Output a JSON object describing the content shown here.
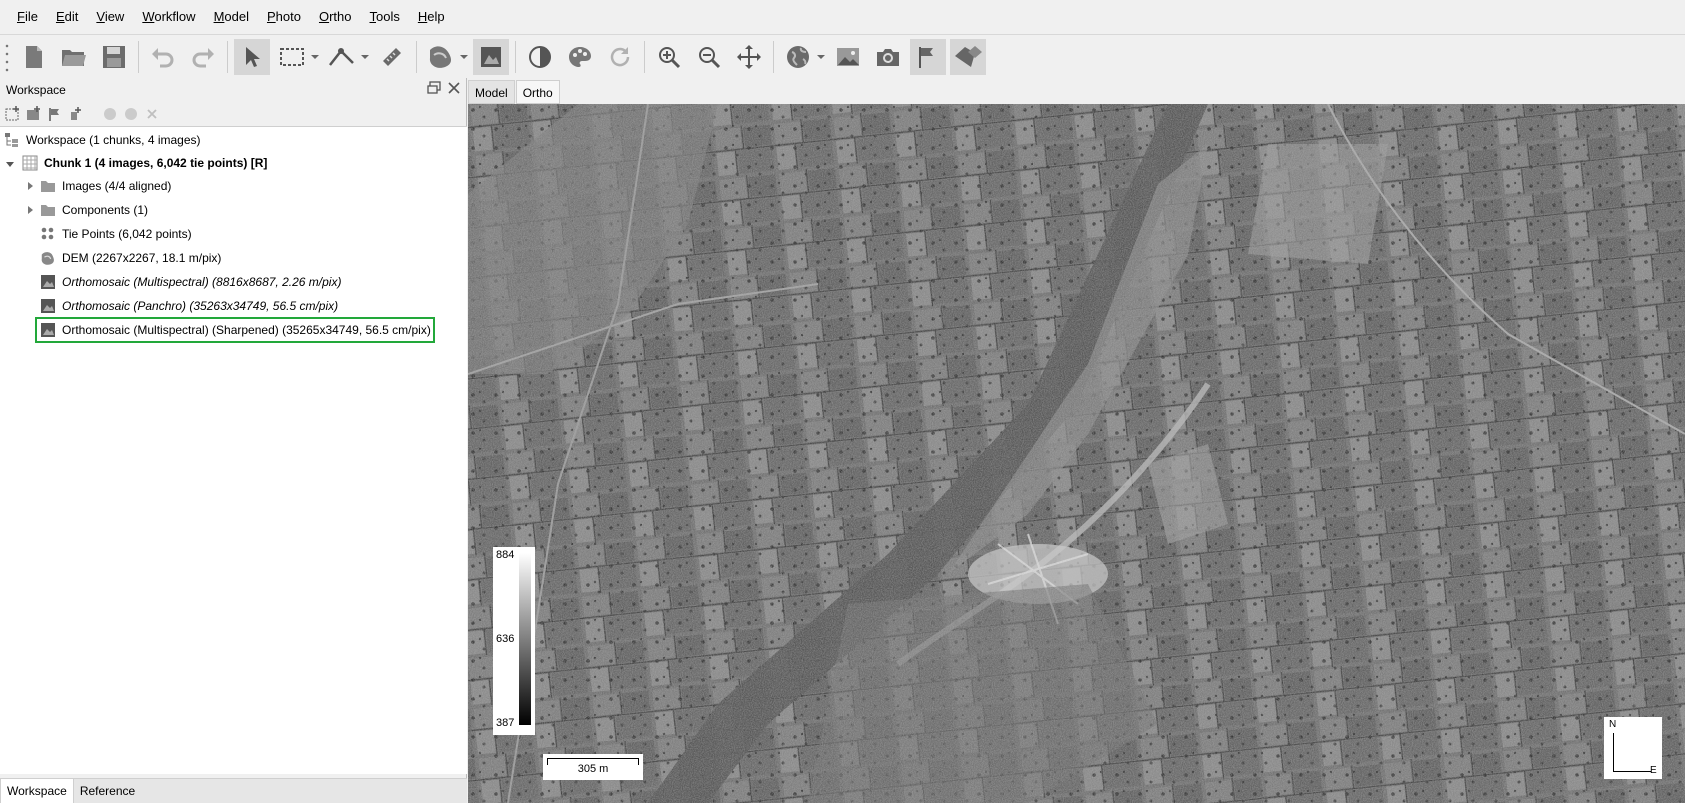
{
  "menu": [
    {
      "label": "File",
      "u": "F",
      "rest": "ile"
    },
    {
      "label": "Edit",
      "u": "E",
      "rest": "dit"
    },
    {
      "label": "View",
      "u": "V",
      "rest": "iew"
    },
    {
      "label": "Workflow",
      "u": "W",
      "rest": "orkflow"
    },
    {
      "label": "Model",
      "u": "M",
      "rest": "odel"
    },
    {
      "label": "Photo",
      "u": "P",
      "rest": "hoto"
    },
    {
      "label": "Ortho",
      "u": "O",
      "rest": "rtho"
    },
    {
      "label": "Tools",
      "u": "T",
      "rest": "ools"
    },
    {
      "label": "Help",
      "u": "H",
      "rest": "elp"
    }
  ],
  "workspace": {
    "title": "Workspace",
    "tree": {
      "root": "Workspace (1 chunks, 4 images)",
      "chunk": "Chunk 1 (4 images, 6,042 tie points) [R]",
      "images": "Images (4/4 aligned)",
      "components": "Components (1)",
      "tie_points": "Tie Points (6,042 points)",
      "dem": "DEM (2267x2267, 18.1 m/pix)",
      "ortho_ms": "Orthomosaic (Multispectral) (8816x8687, 2.26 m/pix)",
      "ortho_pan": "Orthomosaic (Panchro) (35263x34749, 56.5 cm/pix)",
      "ortho_sharp": "Orthomosaic (Multispectral) (Sharpened) (35265x34749, 56.5 cm/pix)"
    },
    "tabs": [
      "Workspace",
      "Reference"
    ]
  },
  "view": {
    "tabs": [
      "Model",
      "Ortho"
    ],
    "legend": {
      "max": "884",
      "mid": "636",
      "min": "387"
    },
    "scale": "305 m",
    "compass": {
      "n": "N",
      "e": "E"
    }
  },
  "colors": {
    "highlight": "#22a83a"
  }
}
